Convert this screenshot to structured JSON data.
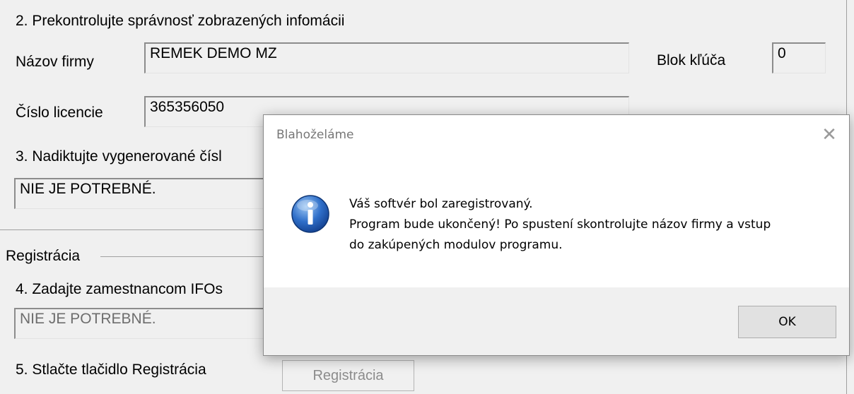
{
  "step2": {
    "heading": "2. Prekontrolujte správnosť zobrazených infomácii",
    "company_label": "Názov firmy",
    "company_value": "REMEK DEMO MZ",
    "key_block_label": "Blok kľúča",
    "key_block_value": "0",
    "license_label": "Číslo licencie",
    "license_value": "365356050"
  },
  "step3": {
    "heading": "3. Nadiktujte vygenerované čísl",
    "value": "NIE JE POTREBNÉ."
  },
  "registration": {
    "group_label": "Registrácia",
    "step4_heading": "4. Zadajte zamestnancom IFOs",
    "step4_value": "NIE JE POTREBNÉ.",
    "step5_heading": "5. Stlačte tlačidlo Registrácia",
    "button_label": "Registrácia"
  },
  "dialog": {
    "title": "Blahoželáme",
    "close_glyph": "✕",
    "icon": "info-icon",
    "message_line1": "Váš softvér bol zaregistrovaný.",
    "message_line2": "Program bude ukončený! Po spustení skontrolujte názov firmy a vstup",
    "message_line3": "do zakúpených modulov programu.",
    "ok_label": "OK"
  }
}
